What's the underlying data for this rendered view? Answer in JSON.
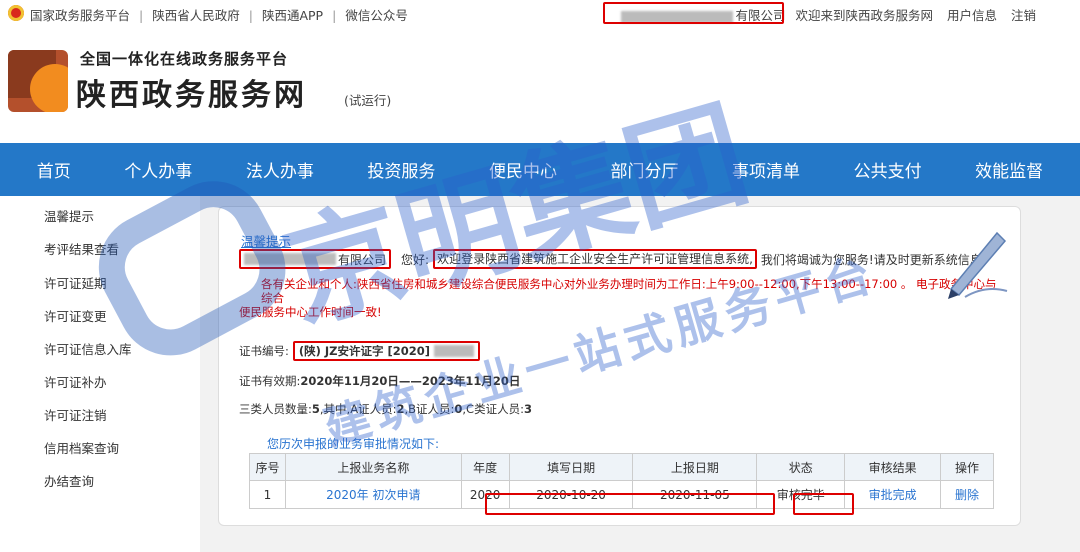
{
  "topbar": {
    "links": [
      "国家政务服务平台",
      "陕西省人民政府",
      "陕西通APP",
      "微信公众号"
    ],
    "company_suffix": "有限公司",
    "welcome": "欢迎来到陕西政务服务网",
    "user_info": "用户信息",
    "logout": "注销"
  },
  "header": {
    "subtitle": "全国一体化在线政务服务平台",
    "title": "陕西政务服务网",
    "trial": "(试运行)"
  },
  "nav": [
    "首页",
    "个人办事",
    "法人办事",
    "投资服务",
    "便民中心",
    "部门分厅",
    "事项清单",
    "公共支付",
    "效能监督"
  ],
  "sidebar": [
    "温馨提示",
    "考评结果查看",
    "许可证延期",
    "许可证变更",
    "许可证信息入库",
    "许可证补办",
    "许可证注销",
    "信用档案查询",
    "办结查询"
  ],
  "main": {
    "tip_title": "温馨提示",
    "company_suffix": "有限公司",
    "greeting": "您好:",
    "welcome_msg": "欢迎登录陕西省建筑施工企业安全生产许可证管理信息系统,",
    "service_msg": "我们将竭诚为您服务!请及时更新系统信息",
    "notice_line1": "各有关企业和个人:陕西省住房和城乡建设综合便民服务中心对外业务办理时间为工作日:上午9:00--12:00,下午13:00--17:00 。 电子政务中心与综合",
    "notice_line2": "便民服务中心工作时间一致!",
    "cert_label": "证书编号:",
    "cert_value": "(陕) JZ安许证字 [2020]",
    "validity_label": "证书有效期:",
    "validity_value": "2020年11月20日——2023年11月20日",
    "counts_label": "三类人员数量:",
    "counts_total": "5",
    "counts_a_label": ",其中,A证人员:",
    "counts_a": "2",
    "counts_b_label": ",B证人员:",
    "counts_b": "0",
    "counts_c_label": ",C类证人员:",
    "counts_c": "3",
    "history_title": "您历次申报的业务审批情况如下:"
  },
  "table": {
    "headers": [
      "序号",
      "上报业务名称",
      "年度",
      "填写日期",
      "上报日期",
      "状态",
      "审核结果",
      "操作"
    ],
    "rows": [
      [
        "1",
        "2020年 初次申请",
        "2020",
        "2020-10-20",
        "2020-11-05",
        "审核完毕",
        "审批完成",
        "删除"
      ]
    ]
  },
  "watermark": {
    "brand": "京明集团",
    "slogan": "建筑企业一站式服务平台"
  },
  "colors": {
    "nav_bg": "#2478c8",
    "link": "#2a74d0",
    "notice": "#d60000",
    "highlight_box": "#dd0000"
  }
}
